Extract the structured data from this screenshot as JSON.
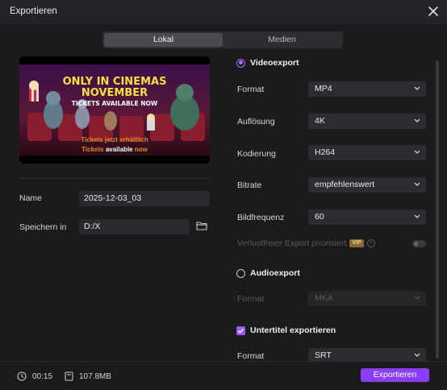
{
  "window": {
    "title": "Exportieren"
  },
  "tabs": [
    {
      "label": "Lokal",
      "active": true
    },
    {
      "label": "Medien",
      "active": false
    }
  ],
  "preview": {
    "headline1": "ONLY IN CINEMAS",
    "headline2": "NOVEMBER",
    "headline3": "TICKETS AVAILABLE NOW",
    "subtitle1": "Tickets jetzt erhältlich",
    "subtitle2_pre": "Tickets ",
    "subtitle2_highlight": "available",
    "subtitle2_post": " now"
  },
  "left": {
    "name_label": "Name",
    "name_value": "2025-12-03_03",
    "save_label": "Speichern in",
    "save_value": "D:/X"
  },
  "video_export": {
    "heading": "Videoexport",
    "rows": [
      {
        "label": "Format",
        "value": "MP4"
      },
      {
        "label": "Auflösung",
        "value": "4K"
      },
      {
        "label": "Kodierung",
        "value": "H264"
      },
      {
        "label": "Bitrate",
        "value": "empfehlenswert"
      },
      {
        "label": "Bildfrequenz",
        "value": "60"
      }
    ],
    "lossless_label": "Verlustfreier Export priorisiert",
    "vip_badge": "VIP",
    "info_symbol": "i"
  },
  "audio_export": {
    "heading": "Audioexport",
    "format_label": "Format",
    "format_value": "MKA"
  },
  "subtitle_export": {
    "heading": "Untertitel exportieren",
    "format_label": "Format",
    "format_value": "SRT"
  },
  "footer": {
    "duration": "00:15",
    "size": "107.8MB",
    "export_button": "Exportieren"
  },
  "colors": {
    "accent": "#8a3dfc",
    "background": "#1b1b1e"
  }
}
